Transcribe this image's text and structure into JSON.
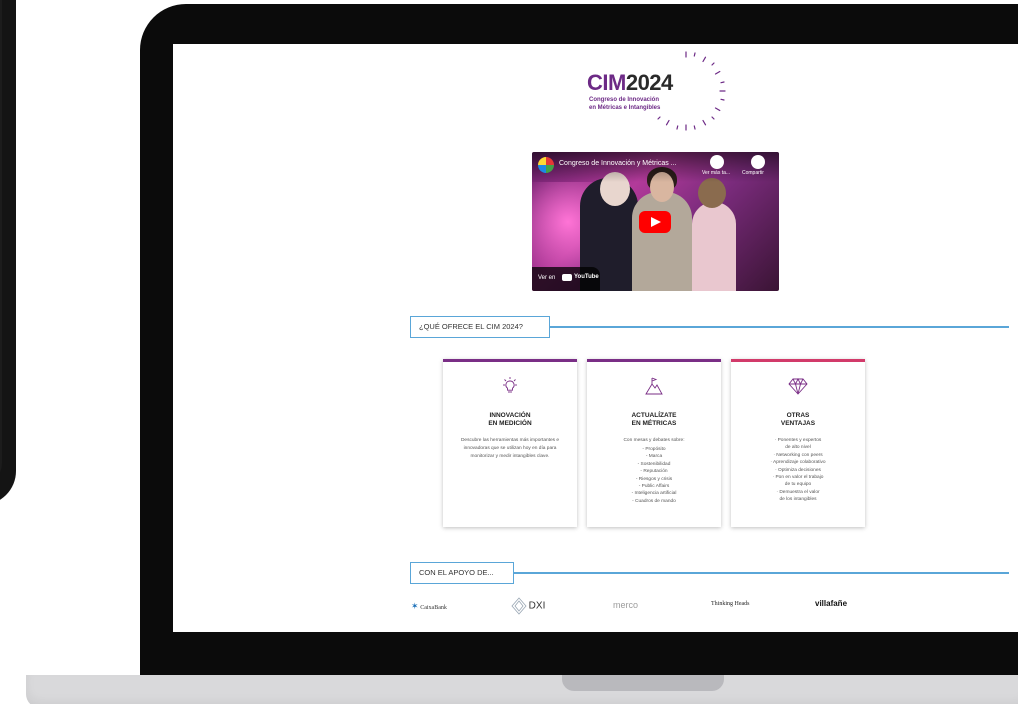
{
  "logo": {
    "cim": "CIM",
    "year": "2024",
    "subtitle_line1": "Congreso de Innovación",
    "subtitle_line2": "en Métricas e Intangibles"
  },
  "video": {
    "title": "Congreso de Innovación y Métricas ...",
    "watch_later": "Ver más ta...",
    "share": "Compartir",
    "watch_on": "Ver en",
    "platform": "YouTube"
  },
  "section_offer": {
    "label": "¿QUÉ OFRECE EL CIM 2024?"
  },
  "cards": [
    {
      "icon": "lightbulb-icon",
      "title_line1": "INNOVACIÓN",
      "title_line2": "EN MEDICIÓN",
      "text": "Descubre las herramientas más importantes e innovadoras que se utilizan hoy en día para monitorizar y medir intangibles clave."
    },
    {
      "icon": "mountain-flag-icon",
      "title_line1": "ACTUALÍZATE",
      "title_line2": "EN MÉTRICAS",
      "intro": "Con mesas y debates sobre:",
      "items": [
        "- Propósito",
        "- Marca",
        "- Sostenibilidad",
        "- Reputación",
        "- Riesgos y crisis",
        "- Public Affairs",
        "- Inteligencia artificial",
        "- Cuadros de mando"
      ]
    },
    {
      "icon": "diamond-icon",
      "title_line1": "OTRAS",
      "title_line2": "VENTAJAS",
      "items": [
        "· Ponentes y expertos",
        "de alto nivel",
        "· Networking con peers",
        "· Aprendizaje colaborativo",
        "· Optimiza decisiones",
        "· Pon en valor el trabajo",
        "de tu equipo",
        "· Demuestra el valor",
        "de los intangibles"
      ]
    }
  ],
  "section_support": {
    "label": "CON EL APOYO DE..."
  },
  "sponsors": {
    "caixabank": "CaixaBank",
    "dxi": "DXI",
    "merco": "merco",
    "thinking_heads": "Thinking Heads",
    "villafane": "villafañe"
  },
  "colors": {
    "purple": "#6d2a86",
    "accent_blue": "#5aa6d8",
    "card_red": "#d23a6a",
    "youtube_red": "#ff0000"
  }
}
